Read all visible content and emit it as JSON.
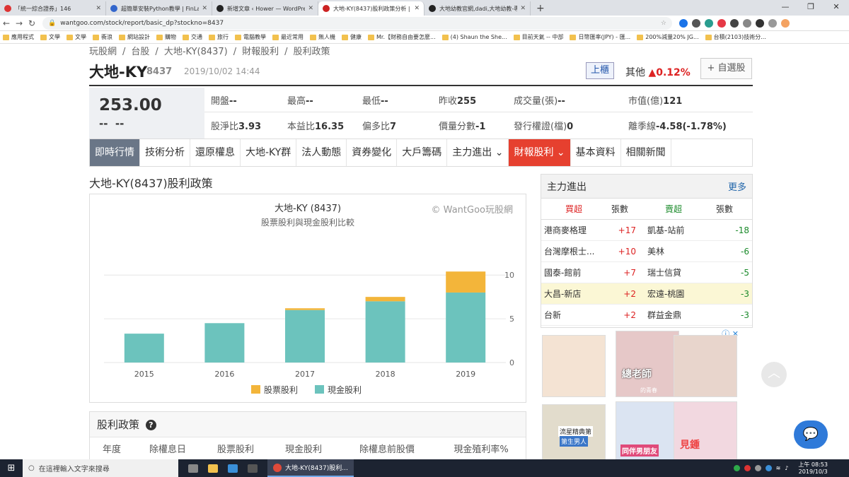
{
  "browser": {
    "tabs": [
      {
        "label": "「統一綜合證券」146",
        "color": "#d33"
      },
      {
        "label": "超簡單安裝Python教學 | FinLab",
        "color": "#36c"
      },
      {
        "label": "新增文章 ‹ Hower — WordPress",
        "color": "#222"
      },
      {
        "label": "大地-KY(8437)股利政策分析 | 台",
        "color": "#c22"
      },
      {
        "label": "大地幼教官網,dadi,大地幼教-專",
        "color": "#222"
      }
    ],
    "new_tab": "+",
    "window_controls": [
      "—",
      "❐",
      "✕"
    ],
    "url": "wantgoo.com/stock/report/basic_dp?stockno=8437",
    "bookmarks": [
      "應用程式",
      "文學",
      "文學",
      "衝浪",
      "網站設計",
      "購物",
      "交通",
      "旅行",
      "電腦教學",
      "最近常用",
      "無人機",
      "健康",
      "Mr.【財務自由要怎麼...",
      "(4) Shaun the She...",
      "目前天氣 -- 中部",
      "日幣匯率(JPY) - 匯...",
      "200%減量20% JG...",
      "台積(2103)技術分..."
    ]
  },
  "breadcrumb": [
    "玩股網",
    "台股",
    "大地-KY(8437)",
    "財報股利",
    "股利政策"
  ],
  "breadcrumb_sep": "/",
  "stock": {
    "name": "大地-KY",
    "code": "8437",
    "datetime": "2019/10/02 14:44",
    "market": "上櫃",
    "other_label": "其他",
    "other_change": "▲0.12%",
    "add_fav": "+ 自選股",
    "price": "253.00",
    "change": "--",
    "change_pct": "--"
  },
  "quote": {
    "row1": [
      {
        "label": "開盤",
        "value": "--"
      },
      {
        "label": "最高",
        "value": "--"
      },
      {
        "label": "最低",
        "value": "--"
      },
      {
        "label": "昨收",
        "value": "255"
      },
      {
        "label": "成交量(張)",
        "value": "--"
      },
      {
        "label": "市值(億)",
        "value": "121"
      }
    ],
    "row2": [
      {
        "label": "股淨比",
        "value": "3.93"
      },
      {
        "label": "本益比",
        "value": "16.35"
      },
      {
        "label": "偏多比",
        "value": "7"
      },
      {
        "label": "價量分數",
        "value": "-1"
      },
      {
        "label": "發行權證(檔)",
        "value": "0"
      },
      {
        "label": "離季線",
        "value": "-4.58(-1.78%)"
      }
    ]
  },
  "menu": [
    "即時行情",
    "技術分析",
    "還原權息",
    "大地-KY群",
    "法人動態",
    "資券變化",
    "大戶籌碼",
    "主力進出 ⌄",
    "財報股利 ⌄",
    "基本資料",
    "相關新聞"
  ],
  "section_title": "大地-KY(8437)股利政策",
  "chart_data": {
    "type": "bar",
    "title": "大地-KY (8437)",
    "subtitle": "股票股利與現金股利比較",
    "credit": "© WantGoo玩股網",
    "categories": [
      "2015",
      "2016",
      "2017",
      "2018",
      "2019"
    ],
    "series": [
      {
        "name": "現金股利",
        "color": "#6cc3bd",
        "values": [
          3.3,
          4.5,
          6.0,
          7.0,
          8.0
        ]
      },
      {
        "name": "股票股利",
        "color": "#f3b53a",
        "values": [
          0,
          0,
          0.2,
          0.5,
          2.4
        ]
      }
    ],
    "stacked": true,
    "yticks": [
      "0",
      "5",
      "10"
    ],
    "ylim": [
      0,
      10.5
    ],
    "legend_position": "bottom"
  },
  "dividend_policy": {
    "title": "股利政策",
    "help": "?",
    "columns": [
      "年度",
      "除權息日",
      "股票股利",
      "現金股利",
      "除權息前股價",
      "現金殖利率%"
    ]
  },
  "main_force": {
    "title": "主力進出",
    "more": "更多",
    "headers": [
      "買超",
      "張數",
      "賣超",
      "張數"
    ],
    "rows": [
      {
        "buy": "港商麥格理",
        "buy_qty": "+17",
        "sell": "凱基-站前",
        "sell_qty": "-18"
      },
      {
        "buy": "台灣摩根士...",
        "buy_qty": "+10",
        "sell": "美林",
        "sell_qty": "-6"
      },
      {
        "buy": "國泰-館前",
        "buy_qty": "+7",
        "sell": "瑞士信貸",
        "sell_qty": "-5"
      },
      {
        "buy": "大昌-新店",
        "buy_qty": "+2",
        "sell": "宏遠-桃園",
        "sell_qty": "-3"
      },
      {
        "buy": "台新",
        "buy_qty": "+2",
        "sell": "群益金鼎",
        "sell_qty": "-3"
      }
    ]
  },
  "ads": {
    "close": "✕",
    "texts": [
      "總老師",
      "的青春",
      "流星精典第",
      "第生男人",
      "同伴男朋友",
      "見鍾"
    ]
  },
  "taskbar": {
    "search_placeholder": "在這裡輸入文字來搜尋",
    "app": "大地-KY(8437)股利...",
    "time": "上午 08:53",
    "date": "2019/10/3"
  }
}
